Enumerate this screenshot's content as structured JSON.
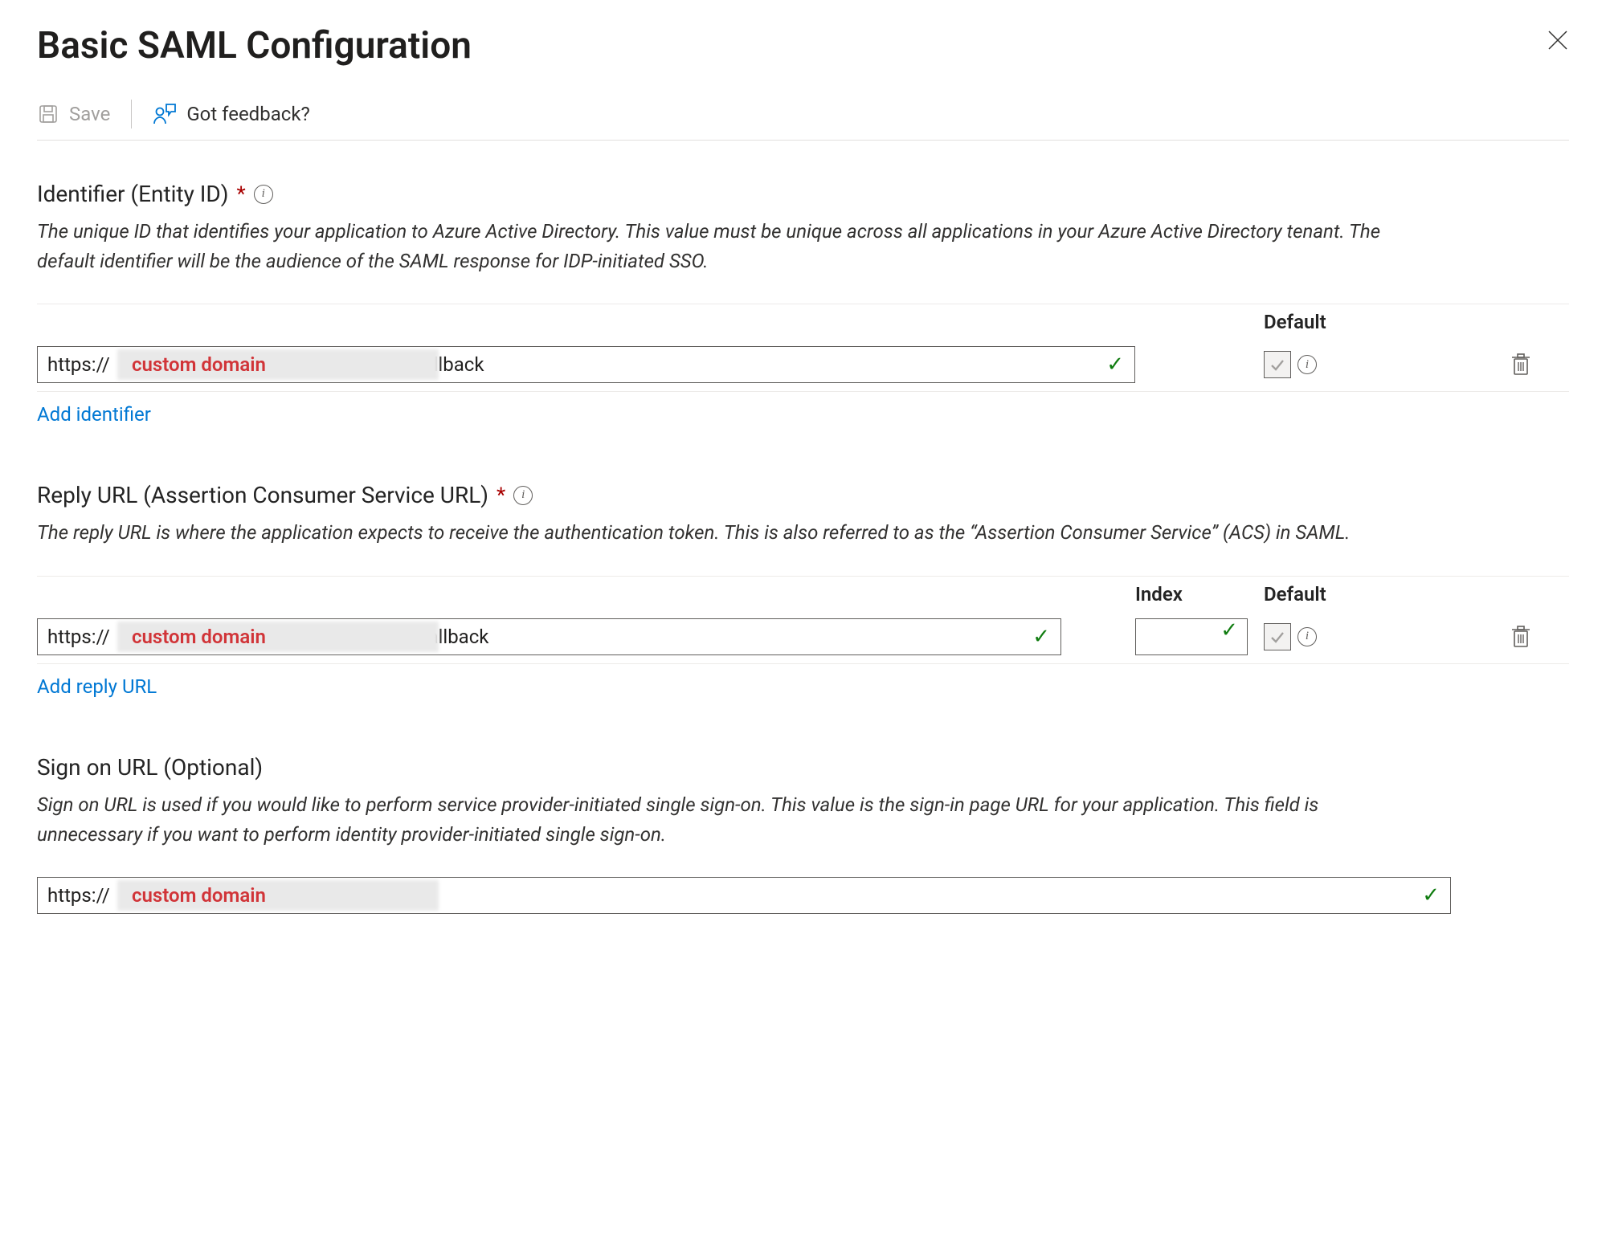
{
  "title": "Basic SAML Configuration",
  "toolbar": {
    "save_label": "Save",
    "feedback_label": "Got feedback?"
  },
  "identifier": {
    "label": "Identifier (Entity ID)",
    "required": true,
    "description": "The unique ID that identifies your application to Azure Active Directory. This value must be unique across all applications in your Azure Active Directory tenant. The default identifier will be the audience of the SAML response for IDP-initiated SSO.",
    "columns": {
      "default": "Default"
    },
    "rows": [
      {
        "prefix": "https://",
        "redacted_note": "custom domain",
        "suffix": "/auth/dex/callback",
        "default_checked": false
      }
    ],
    "add_link": "Add identifier"
  },
  "reply_url": {
    "label": "Reply URL (Assertion Consumer Service URL)",
    "required": true,
    "description": "The reply URL is where the application expects to receive the authentication token. This is also referred to as the “Assertion Consumer Service” (ACS) in SAML.",
    "columns": {
      "index": "Index",
      "default": "Default"
    },
    "rows": [
      {
        "prefix": "https://",
        "redacted_note": "custom domain",
        "suffix": "/auth/dex/callback",
        "index": "",
        "default_checked": false
      }
    ],
    "add_link": "Add reply URL"
  },
  "sign_on": {
    "label": "Sign on URL (Optional)",
    "required": false,
    "description": "Sign on URL is used if you would like to perform service provider-initiated single sign-on. This value is the sign-in page URL for your application. This field is unnecessary if you want to perform identity provider-initiated single sign-on.",
    "value_prefix": "https://",
    "redacted_note": "custom domain"
  }
}
